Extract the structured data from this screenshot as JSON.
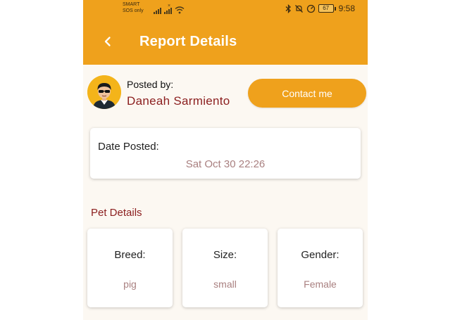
{
  "status_bar": {
    "carrier_line1": "SMART",
    "carrier_line2": "SOS only",
    "battery_level": "67",
    "time": "9:58",
    "icons": [
      "signal-icon",
      "signal-x-icon",
      "wifi-icon",
      "bluetooth-icon",
      "mute-icon",
      "speed-icon",
      "battery-icon"
    ]
  },
  "app_bar": {
    "title": "Report Details",
    "back_icon": "chevron-left-icon",
    "color": "#efa11c"
  },
  "poster": {
    "label": "Posted by:",
    "name": "Daneah Sarmiento",
    "avatar_icon": "avatar-sunglasses",
    "contact_label": "Contact me"
  },
  "date": {
    "label": "Date Posted:",
    "value": "Sat Oct 30 22:26"
  },
  "pet_details": {
    "title": "Pet Details",
    "items": [
      {
        "label": "Breed:",
        "value": "pig"
      },
      {
        "label": "Size:",
        "value": "small"
      },
      {
        "label": "Gender:",
        "value": "Female"
      }
    ]
  },
  "colors": {
    "accent": "#efa11c",
    "name_text": "#8b1e1e",
    "value_text": "#a98080",
    "background": "#fcf8f2"
  }
}
